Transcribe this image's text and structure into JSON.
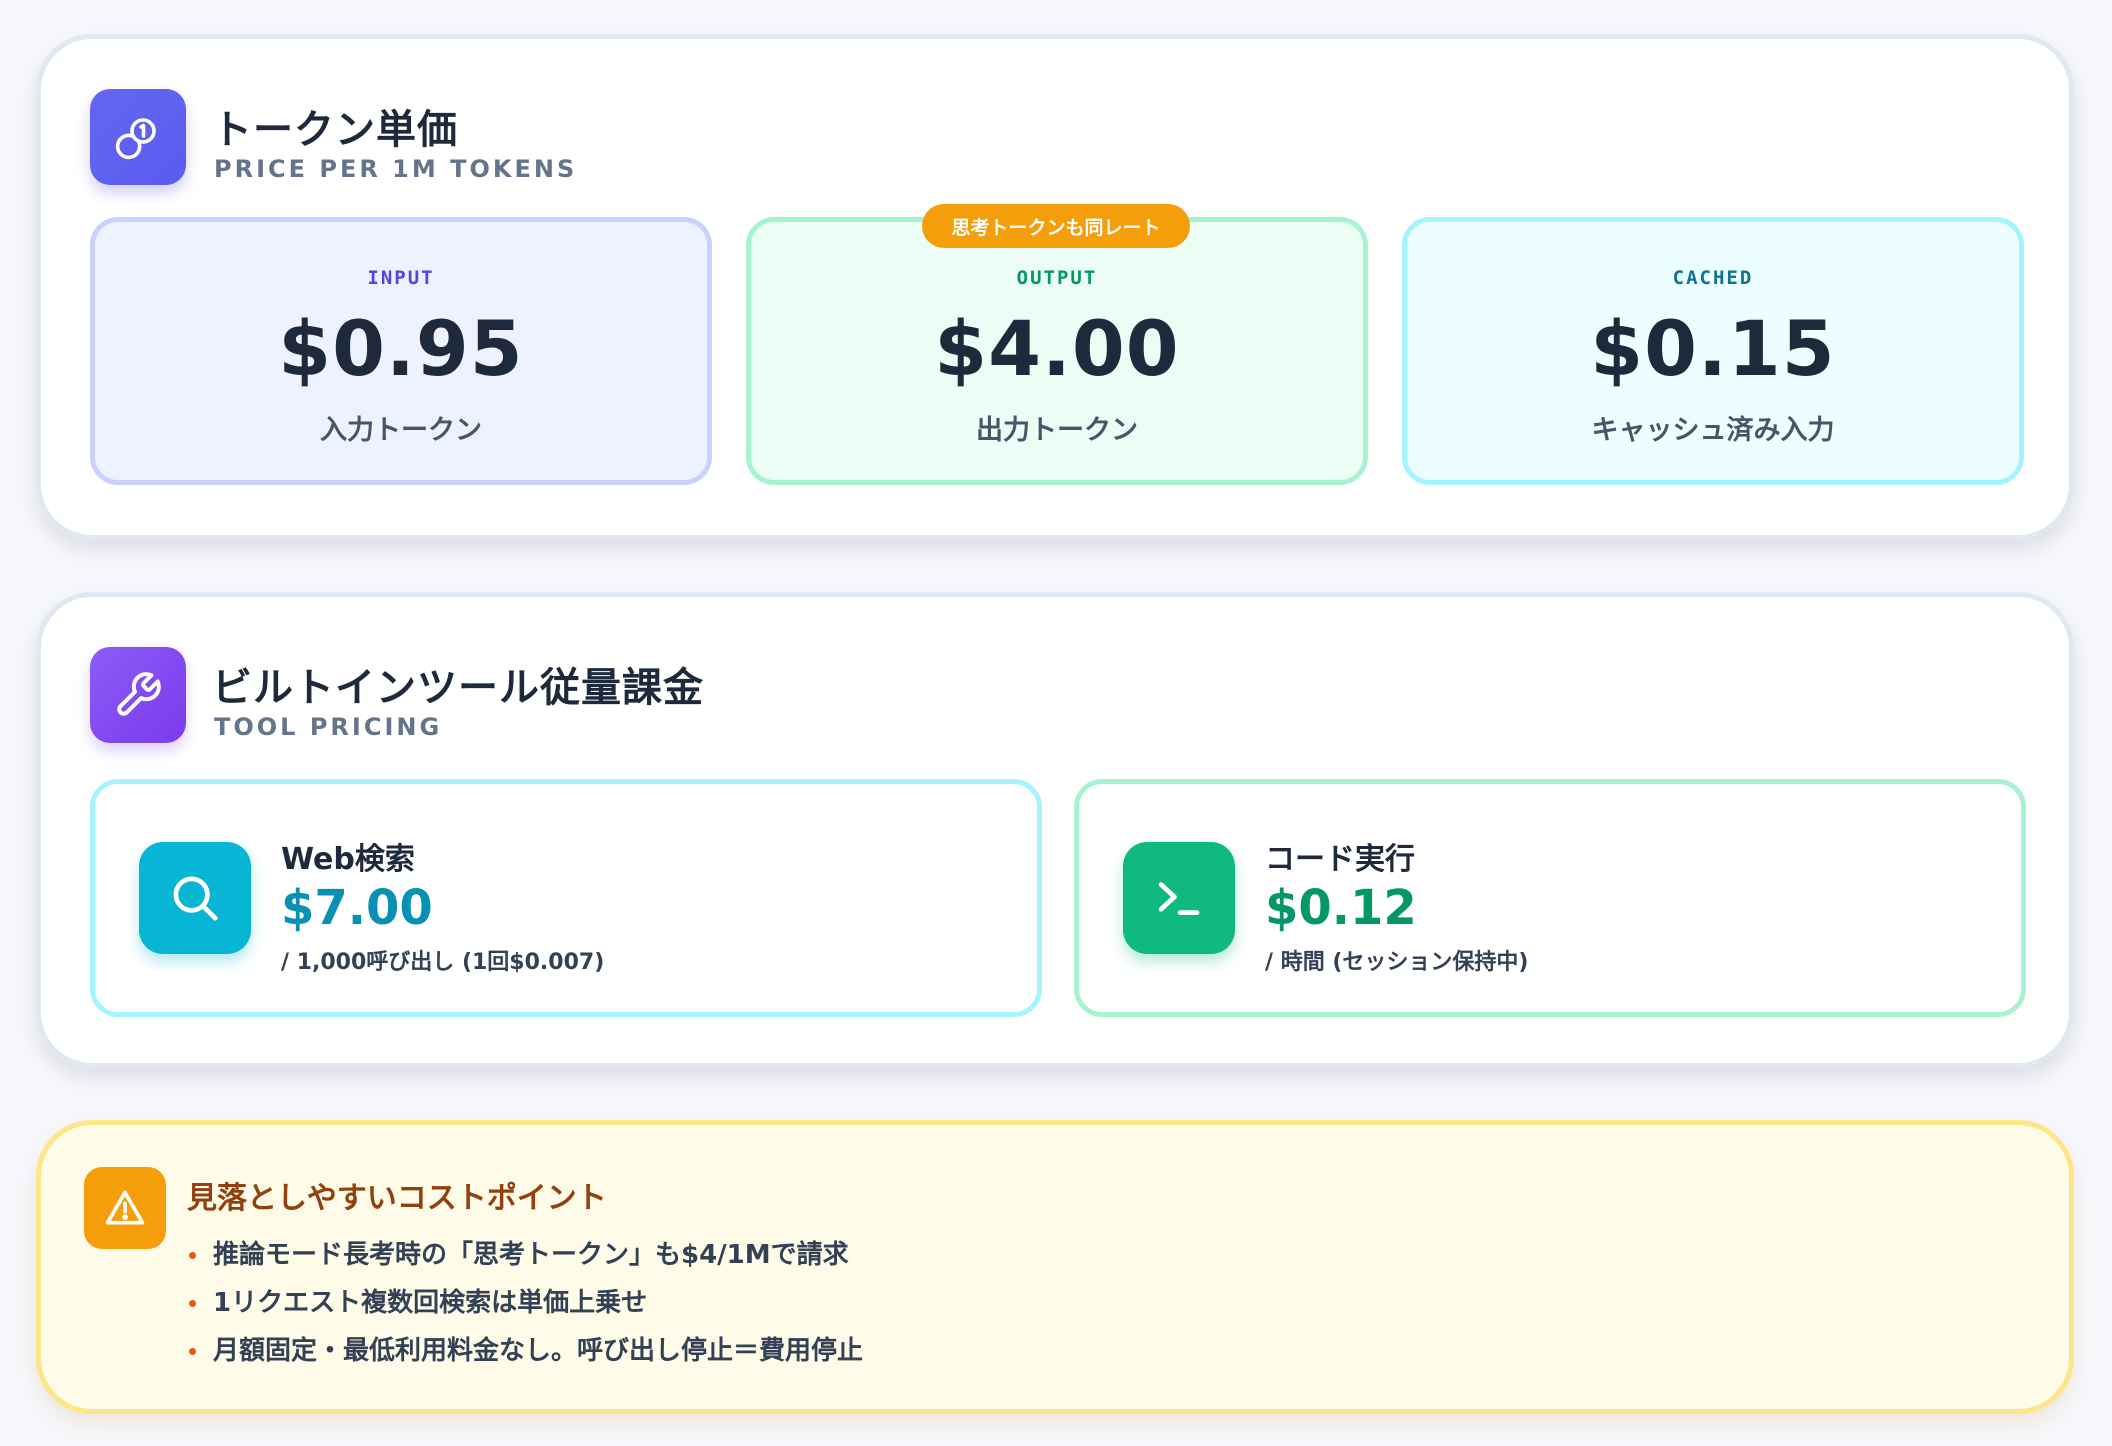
{
  "token_section": {
    "title": "トークン単価",
    "subtitle": "PRICE PER 1M TOKENS",
    "icon": "coins-icon",
    "accent": "#6366f1",
    "input": {
      "label": "INPUT",
      "price": "$0.95",
      "desc": "入力トークン",
      "color": "#4f46e5"
    },
    "output": {
      "label": "OUTPUT",
      "price": "$4.00",
      "desc": "出力トークン",
      "badge": "思考トークンも同レート",
      "color": "#059669"
    },
    "cached": {
      "label": "CACHED",
      "price": "$0.15",
      "desc": "キャッシュ済み入力",
      "color": "#0e7490"
    }
  },
  "tool_section": {
    "title": "ビルトインツール従量課金",
    "subtitle": "TOOL PRICING",
    "icon": "wrench-icon",
    "accent": "#8b5cf6",
    "web_search": {
      "name": "Web検索",
      "price": "$7.00",
      "unit": "/ 1,000呼び出し (1回$0.007)",
      "icon": "search-icon",
      "color": "#06b6d4"
    },
    "code_exec": {
      "name": "コード実行",
      "price": "$0.12",
      "unit": "/ 時間 (セッション保持中)",
      "icon": "terminal-icon",
      "color": "#10b981"
    }
  },
  "cost_note": {
    "title": "見落としやすいコストポイント",
    "icon": "warning-icon",
    "color": "#f59e0b",
    "items": [
      "推論モード長考時の「思考トークン」も$4/1Mで請求",
      "1リクエスト複数回検索は単価上乗せ",
      "月額固定・最低利用料金なし。呼び出し停止＝費用停止"
    ]
  }
}
